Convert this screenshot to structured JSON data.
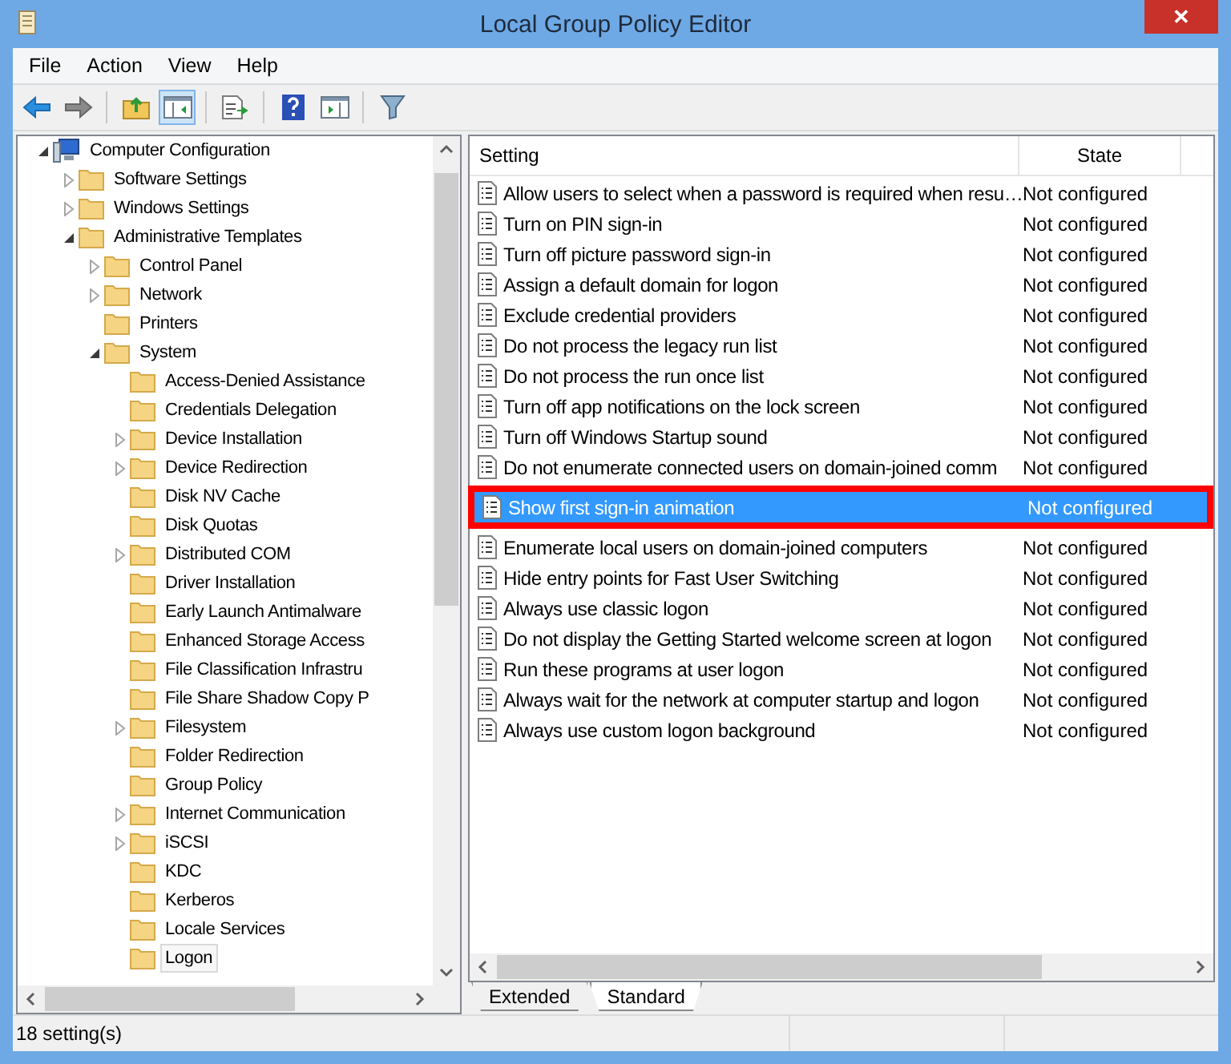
{
  "window": {
    "title": "Local Group Policy Editor",
    "close": "✕"
  },
  "menu": [
    "File",
    "Action",
    "View",
    "Help"
  ],
  "tree": [
    {
      "label": "Computer Configuration",
      "kind": "computer",
      "expanded": true,
      "selected": false,
      "children": [
        {
          "label": "Software Settings",
          "kind": "folder",
          "expanded": false,
          "selected": false
        },
        {
          "label": "Windows Settings",
          "kind": "folder",
          "expanded": false,
          "selected": false
        },
        {
          "label": "Administrative Templates",
          "kind": "folder",
          "expanded": true,
          "selected": false,
          "children": [
            {
              "label": "Control Panel",
              "kind": "folder",
              "expanded": false,
              "selected": false
            },
            {
              "label": "Network",
              "kind": "folder",
              "expanded": false,
              "selected": false
            },
            {
              "label": "Printers",
              "kind": "folder",
              "selected": false
            },
            {
              "label": "System",
              "kind": "folder",
              "expanded": true,
              "selected": false,
              "children": [
                {
                  "label": "Access-Denied Assistance",
                  "kind": "folder",
                  "selected": false
                },
                {
                  "label": "Credentials Delegation",
                  "kind": "folder",
                  "selected": false
                },
                {
                  "label": "Device Installation",
                  "kind": "folder",
                  "expanded": false,
                  "selected": false
                },
                {
                  "label": "Device Redirection",
                  "kind": "folder",
                  "expanded": false,
                  "selected": false
                },
                {
                  "label": "Disk NV Cache",
                  "kind": "folder",
                  "selected": false
                },
                {
                  "label": "Disk Quotas",
                  "kind": "folder",
                  "selected": false
                },
                {
                  "label": "Distributed COM",
                  "kind": "folder",
                  "expanded": false,
                  "selected": false
                },
                {
                  "label": "Driver Installation",
                  "kind": "folder",
                  "selected": false
                },
                {
                  "label": "Early Launch Antimalware",
                  "kind": "folder",
                  "selected": false
                },
                {
                  "label": "Enhanced Storage Access",
                  "kind": "folder",
                  "selected": false
                },
                {
                  "label": "File Classification Infrastru",
                  "kind": "folder",
                  "selected": false
                },
                {
                  "label": "File Share Shadow Copy P",
                  "kind": "folder",
                  "selected": false
                },
                {
                  "label": "Filesystem",
                  "kind": "folder",
                  "expanded": false,
                  "selected": false
                },
                {
                  "label": "Folder Redirection",
                  "kind": "folder",
                  "selected": false
                },
                {
                  "label": "Group Policy",
                  "kind": "folder",
                  "selected": false
                },
                {
                  "label": "Internet Communication",
                  "kind": "folder",
                  "expanded": false,
                  "selected": false
                },
                {
                  "label": "iSCSI",
                  "kind": "folder",
                  "expanded": false,
                  "selected": false
                },
                {
                  "label": "KDC",
                  "kind": "folder",
                  "selected": false
                },
                {
                  "label": "Kerberos",
                  "kind": "folder",
                  "selected": false
                },
                {
                  "label": "Locale Services",
                  "kind": "folder",
                  "selected": false
                },
                {
                  "label": "Logon",
                  "kind": "folder",
                  "selected": true
                }
              ]
            }
          ]
        }
      ]
    }
  ],
  "table": {
    "columns": [
      "Setting",
      "State"
    ],
    "rows": [
      {
        "setting": "Allow users to select when a password is required when resu…",
        "state": "Not configured",
        "selected": false
      },
      {
        "setting": "Turn on PIN sign-in",
        "state": "Not configured",
        "selected": false
      },
      {
        "setting": "Turn off picture password sign-in",
        "state": "Not configured",
        "selected": false
      },
      {
        "setting": "Assign a default domain for logon",
        "state": "Not configured",
        "selected": false
      },
      {
        "setting": "Exclude credential providers",
        "state": "Not configured",
        "selected": false
      },
      {
        "setting": "Do not process the legacy run list",
        "state": "Not configured",
        "selected": false
      },
      {
        "setting": "Do not process the run once list",
        "state": "Not configured",
        "selected": false
      },
      {
        "setting": "Turn off app notifications on the lock screen",
        "state": "Not configured",
        "selected": false
      },
      {
        "setting": "Turn off Windows Startup sound",
        "state": "Not configured",
        "selected": false
      },
      {
        "setting": "Do not enumerate connected users on domain-joined comm",
        "state": "Not configured",
        "selected": false
      },
      {
        "setting": "Show first sign-in animation",
        "state": "Not configured",
        "selected": true
      },
      {
        "setting": "Enumerate local users on domain-joined computers",
        "state": "Not configured",
        "selected": false
      },
      {
        "setting": "Hide entry points for Fast User Switching",
        "state": "Not configured",
        "selected": false
      },
      {
        "setting": "Always use classic logon",
        "state": "Not configured",
        "selected": false
      },
      {
        "setting": "Do not display the Getting Started welcome screen at logon",
        "state": "Not configured",
        "selected": false
      },
      {
        "setting": "Run these programs at user logon",
        "state": "Not configured",
        "selected": false
      },
      {
        "setting": "Always wait for the network at computer startup and logon",
        "state": "Not configured",
        "selected": false
      },
      {
        "setting": "Always use custom logon background",
        "state": "Not configured",
        "selected": false
      }
    ]
  },
  "tabs": [
    {
      "label": "Extended",
      "selected": false
    },
    {
      "label": "Standard",
      "selected": true
    }
  ],
  "status_bar": "18 setting(s)"
}
